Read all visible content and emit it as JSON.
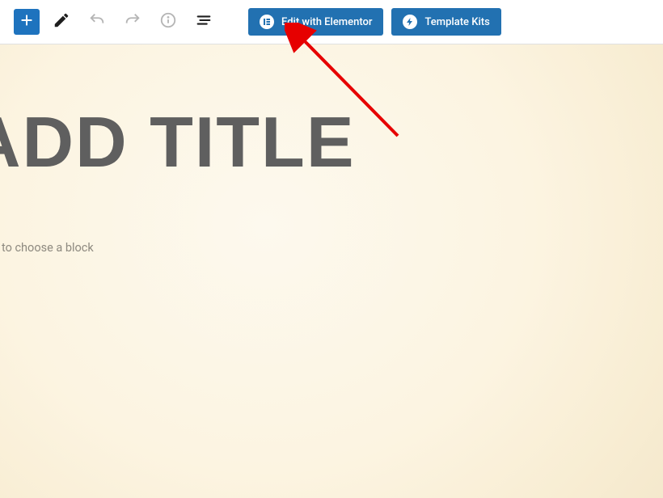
{
  "toolbar": {
    "elementor_label": "Edit with Elementor",
    "template_kits_label": "Template Kits"
  },
  "editor": {
    "title_placeholder": "ADD TITLE",
    "block_hint": "to choose a block"
  }
}
